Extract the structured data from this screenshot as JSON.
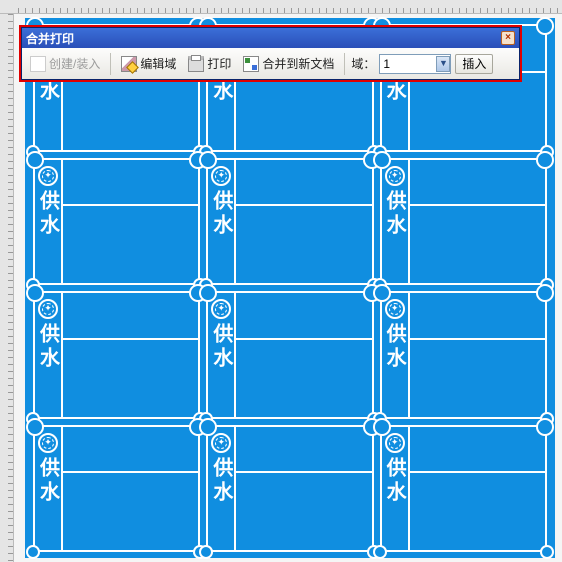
{
  "dialog": {
    "title": "合并打印",
    "close_label": "×",
    "buttons": {
      "create_load": "创建/装入",
      "edit_field": "编辑域",
      "print": "打印",
      "merge_newdoc": "合并到新文档"
    },
    "field_label": "域：",
    "field_value": "1",
    "insert_label": "插入"
  },
  "card": {
    "label": "供水"
  }
}
